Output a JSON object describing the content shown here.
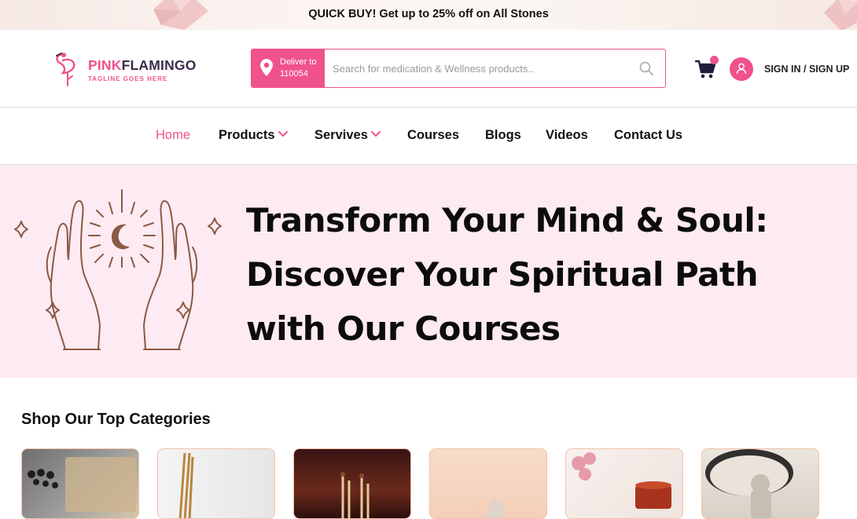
{
  "promo": {
    "text": "QUICK BUY! Get up to 25% off on All Stones"
  },
  "header": {
    "logo": {
      "brand_part1": "PINK",
      "brand_part2": "FLAMINGO",
      "tagline": "TAGLINE GOES HERE"
    },
    "deliver": {
      "line1": "Deliver to",
      "line2": "110054"
    },
    "search": {
      "placeholder": "Search for medication & Wellness products.."
    },
    "signin_label": "SIGN IN / SIGN UP"
  },
  "nav": {
    "items": [
      {
        "label": "Home",
        "active": true
      },
      {
        "label": "Products",
        "dropdown": true
      },
      {
        "label": "Servives",
        "dropdown": true
      },
      {
        "label": "Courses"
      },
      {
        "label": "Blogs"
      },
      {
        "label": "Videos"
      },
      {
        "label": "Contact Us"
      }
    ]
  },
  "hero": {
    "title_line1": "Transform Your Mind & Soul:",
    "title_line2": "Discover Your Spiritual Path",
    "title_line3": "with Our Courses"
  },
  "categories": {
    "title": "Shop Our Top Categories",
    "items": [
      {
        "image": "rudraksha-mala-on-paper"
      },
      {
        "image": "incense-sticks"
      },
      {
        "image": "temple-incense"
      },
      {
        "image": "crystal-stones"
      },
      {
        "image": "roses-and-tea"
      },
      {
        "image": "buddha-statue"
      }
    ]
  },
  "colors": {
    "accent": "#f0528c",
    "hero_bg": "#fdeaf2",
    "art_stroke": "#8a5a43"
  }
}
